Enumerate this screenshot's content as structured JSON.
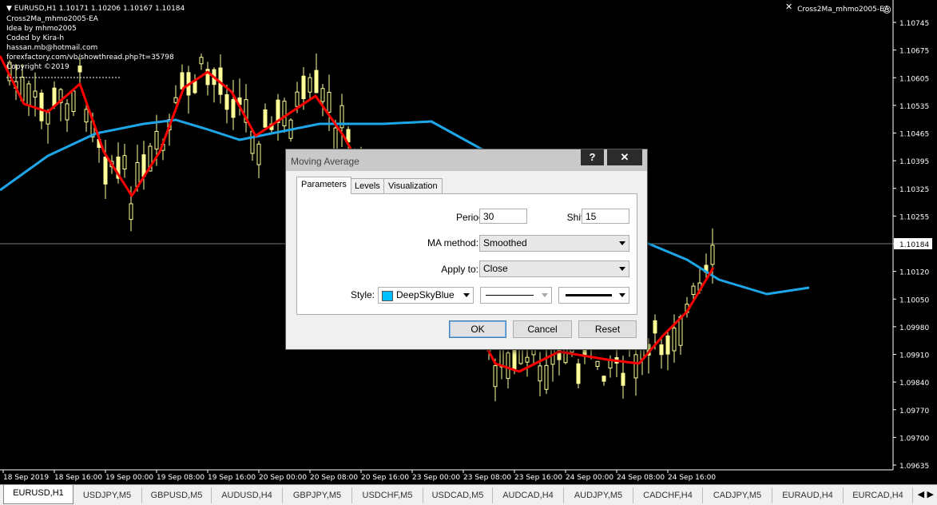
{
  "chart": {
    "header_symbol": "EURUSD,H1",
    "header_ohlc": "1.10171 1.10206 1.10167 1.10184",
    "info_lines": [
      "Cross2Ma_mhmo2005-EA",
      "Idea by mhmo2005",
      "Coded by Kira-h",
      "hassan.mb@hotmail.com",
      "forexfactory.com/vb/showthread.php?t=35798",
      "Copyright ©2019"
    ],
    "ea_name": "Cross2Ma_mhmo2005-EA",
    "price_labels": [
      "1.10745",
      "1.10675",
      "1.10605",
      "1.10535",
      "1.10465",
      "1.10395",
      "1.10325",
      "1.10255",
      "1.10184",
      "1.10120",
      "1.10050",
      "1.09980",
      "1.09910",
      "1.09840",
      "1.09770",
      "1.09700",
      "1.09635"
    ],
    "current_price": "1.10184",
    "time_labels": [
      "18 Sep 2019",
      "18 Sep 16:00",
      "19 Sep 00:00",
      "19 Sep 08:00",
      "19 Sep 16:00",
      "20 Sep 00:00",
      "20 Sep 08:00",
      "20 Sep 16:00",
      "23 Sep 00:00",
      "23 Sep 08:00",
      "23 Sep 16:00",
      "24 Sep 00:00",
      "24 Sep 08:00",
      "24 Sep 16:00"
    ],
    "colors": {
      "candle": "#ffff99",
      "ma_fast": "#ff0000",
      "ma_slow": "#1ea7e8",
      "background": "#000000",
      "text": "#ffffff"
    }
  },
  "dialog": {
    "title": "Moving Average",
    "help_label": "?",
    "close_label": "✕",
    "tabs": [
      "Parameters",
      "Levels",
      "Visualization"
    ],
    "period_label": "Period:",
    "period_value": "30",
    "shift_label": "Shift:",
    "shift_value": "15",
    "method_label": "MA method:",
    "method_value": "Smoothed",
    "apply_label": "Apply to:",
    "apply_value": "Close",
    "style_label": "Style:",
    "style_color_name": "DeepSkyBlue",
    "style_color": "#00bfff",
    "ok_label": "OK",
    "cancel_label": "Cancel",
    "reset_label": "Reset"
  },
  "tabstrip": {
    "tabs": [
      "EURUSD,H1",
      "USDJPY,M5",
      "GBPUSD,M5",
      "AUDUSD,H4",
      "GBPJPY,M5",
      "USDCHF,M5",
      "USDCAD,M5",
      "AUDCAD,H4",
      "AUDJPY,M5",
      "CADCHF,H4",
      "CADJPY,M5",
      "EURAUD,H4",
      "EURCAD,H4"
    ],
    "active": "EURUSD,H1"
  }
}
